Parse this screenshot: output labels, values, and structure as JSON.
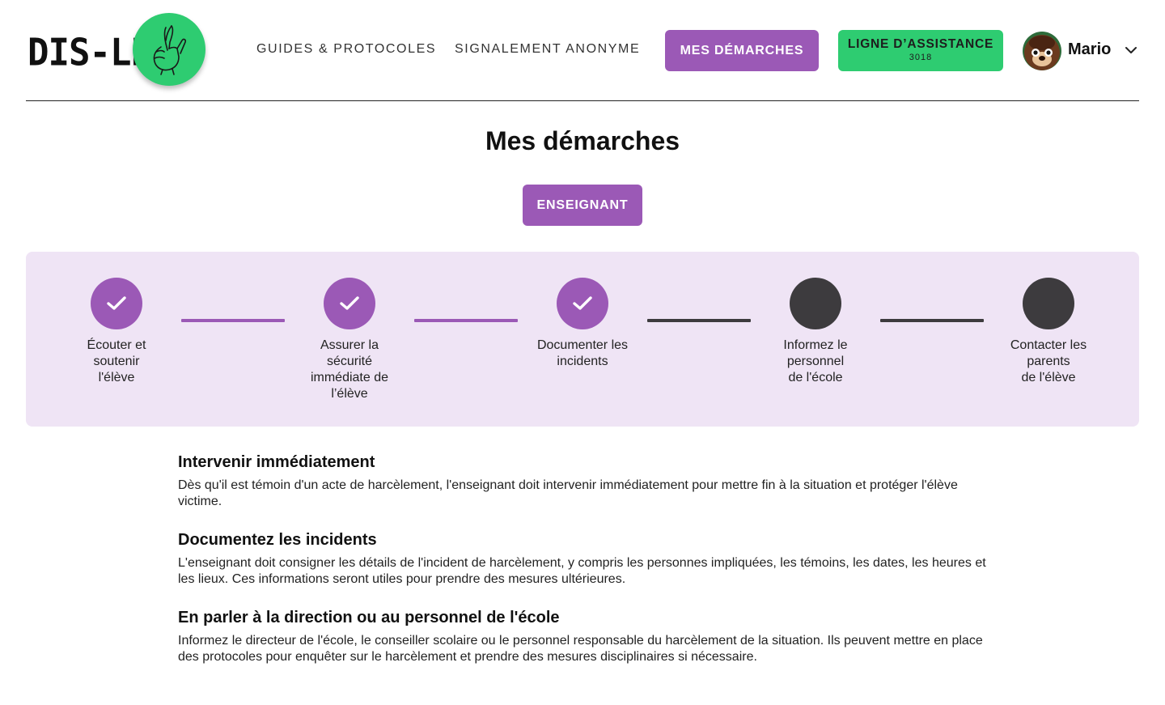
{
  "header": {
    "logo_text": "DIS-LE",
    "nav": [
      {
        "label": "GUIDES & PROTOCOLES"
      },
      {
        "label": "SIGNALEMENT ANONYME"
      }
    ],
    "active_button": "MES DÉMARCHES",
    "helpline": {
      "label": "LIGNE D’ASSISTANCE",
      "number": "3018"
    },
    "user": {
      "name": "Mario"
    }
  },
  "page": {
    "title": "Mes démarches",
    "role_button": "ENSEIGNANT"
  },
  "stepper": {
    "steps": [
      {
        "label": "Écouter et\nsoutenir\nl'élève",
        "status": "done"
      },
      {
        "label": "Assurer la\nsécurité\nimmédiate de\nl’élève",
        "status": "done"
      },
      {
        "label": "Documenter les\nincidents",
        "status": "done"
      },
      {
        "label": "Informez le\npersonnel\nde l'école",
        "status": "todo"
      },
      {
        "label": "Contacter les\nparents\nde l'élève",
        "status": "todo"
      }
    ]
  },
  "sections": [
    {
      "title": "Intervenir immédiatement",
      "text": "Dès qu'il est témoin d'un acte de harcèlement, l'enseignant doit intervenir immédiatement pour mettre fin à la situation et protéger l'élève victime."
    },
    {
      "title": "Documentez les incidents",
      "text": "L'enseignant doit consigner les détails de l'incident de harcèlement, y compris les personnes impliquées, les témoins, les dates, les heures et les lieux. Ces informations seront utiles pour prendre des mesures ultérieures."
    },
    {
      "title": "En parler à la direction ou au personnel de l'école",
      "text": "Informez le directeur de l'école, le conseiller scolaire ou le personnel responsable du harcèlement de la situation. Ils peuvent mettre en place des protocoles pour enquêter sur le harcèlement et prendre des mesures disciplinaires si nécessaire."
    }
  ],
  "colors": {
    "purple": "#9b59b6",
    "green": "#2ecc71",
    "dark": "#3d3b3e",
    "stepper_bg": "#efe4f5"
  }
}
